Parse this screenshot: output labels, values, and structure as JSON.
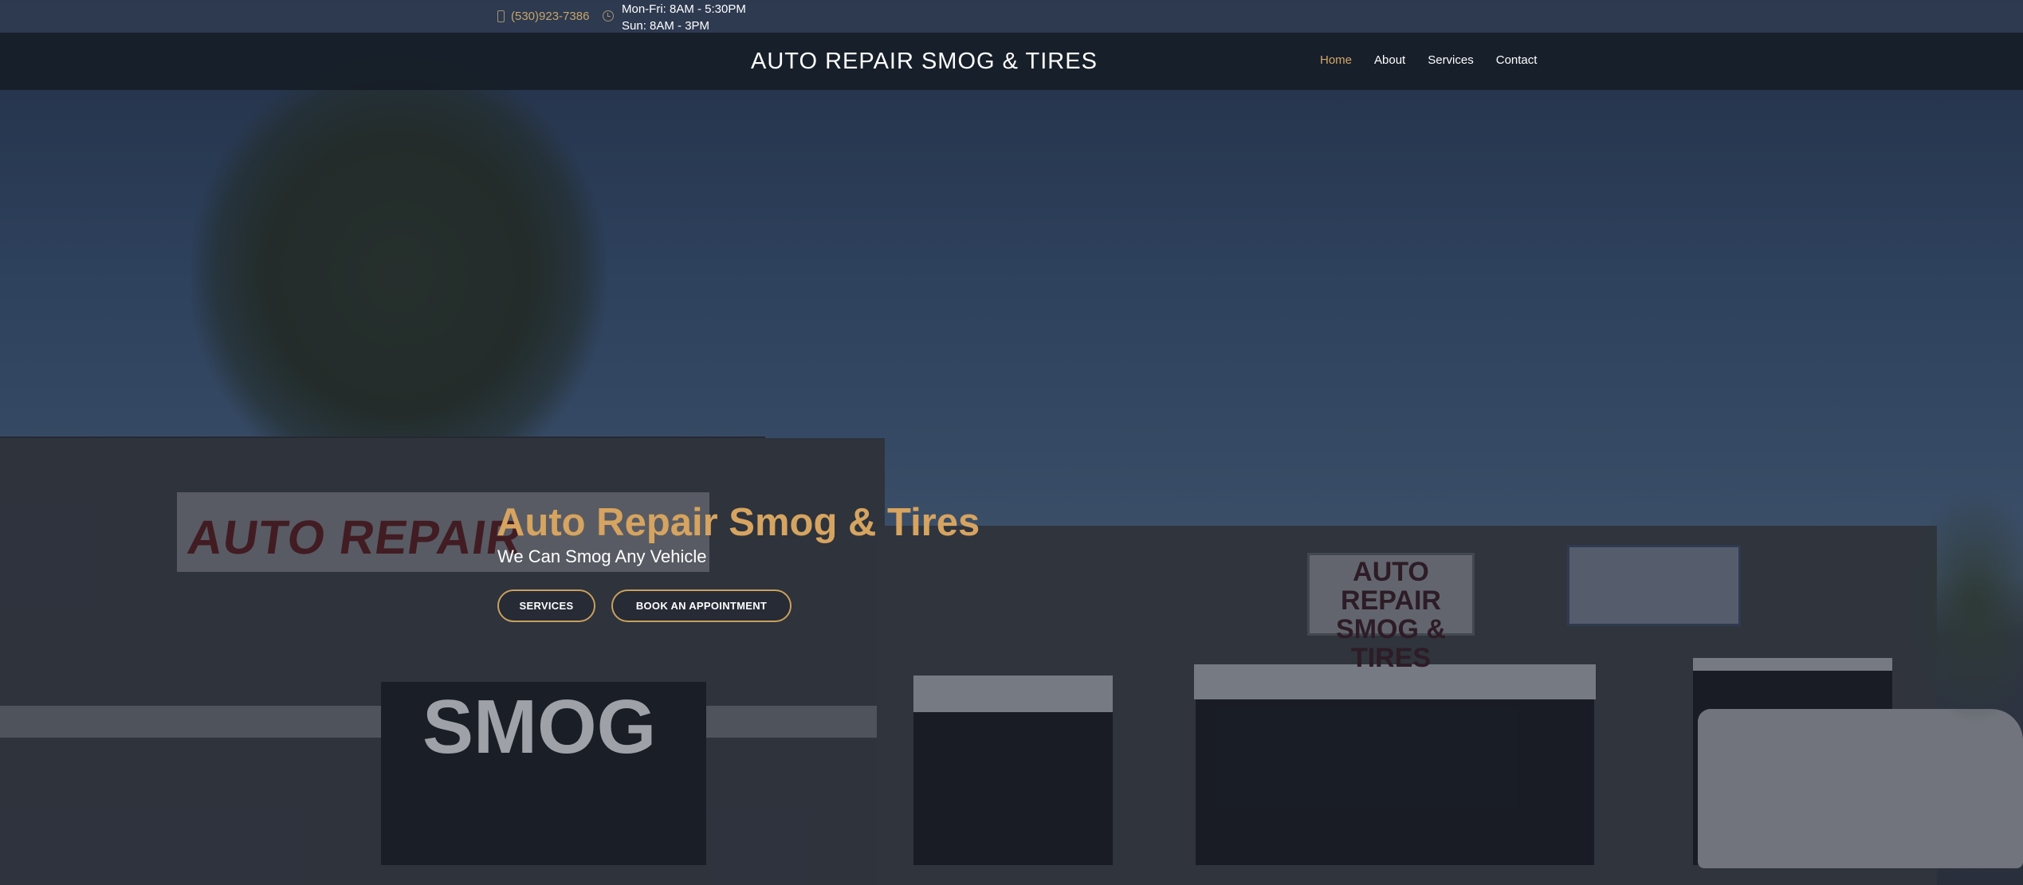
{
  "topbar": {
    "phone_icon": "phone-icon",
    "phone": "(530)923-7386",
    "clock_icon": "clock-icon",
    "hours": [
      "Mon-Fri: 8AM - 5:30PM",
      "Sun: 8AM - 3PM"
    ]
  },
  "nav": {
    "brand": "AUTO REPAIR SMOG & TIRES",
    "links": [
      {
        "label": "Home",
        "active": true
      },
      {
        "label": "About",
        "active": false
      },
      {
        "label": "Services",
        "active": false
      },
      {
        "label": "Contact",
        "active": false
      }
    ]
  },
  "hero": {
    "title": "Auto Repair Smog & Tires",
    "subtitle": "We Can Smog Any Vehicle",
    "buttons": {
      "services": "SERVICES",
      "book": "BOOK AN APPOINTMENT"
    },
    "photo_signs": {
      "left_sign": "AUTO REPAIR",
      "window": "SMOG",
      "center_sign": "AUTO REPAIR SMOG & TIRES"
    }
  },
  "colors": {
    "accent": "#d6a460",
    "nav_bg": "#161c26",
    "text": "#ffffff"
  }
}
